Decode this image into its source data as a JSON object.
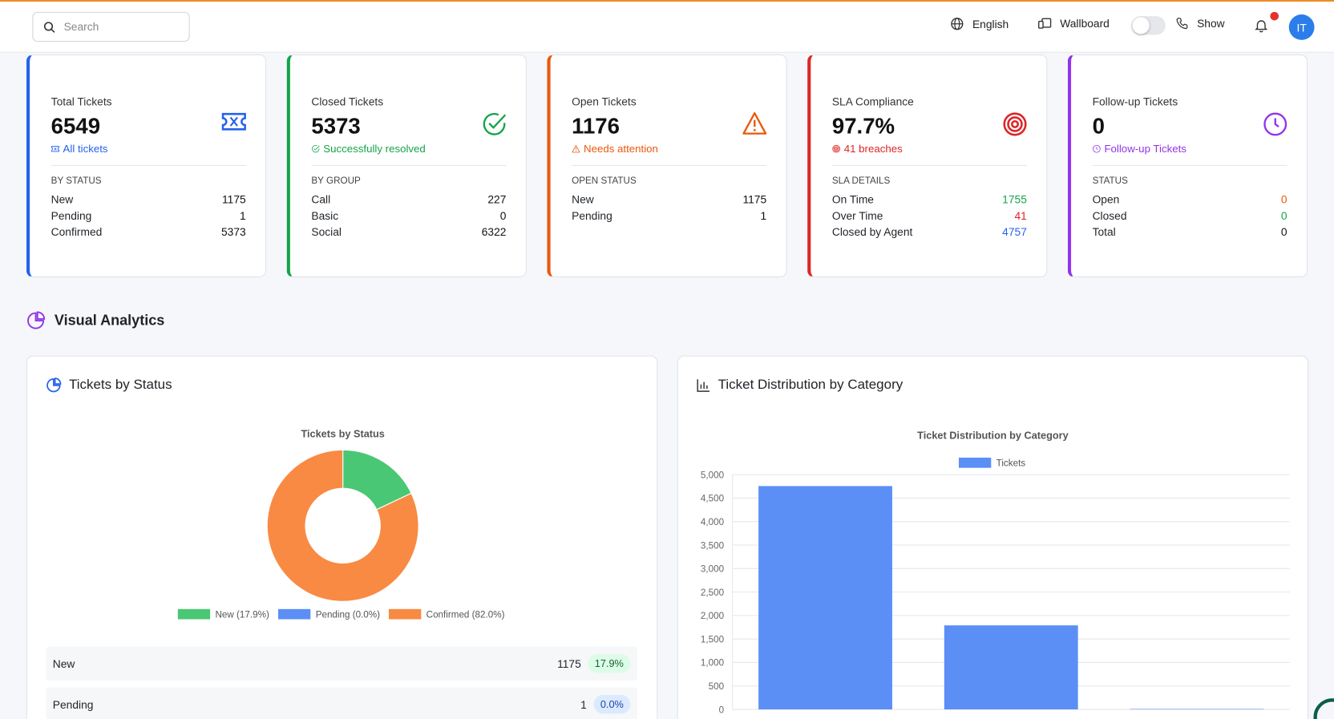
{
  "header": {
    "search_placeholder": "Search",
    "language": "English",
    "wallboard": "Wallboard",
    "show": "Show",
    "avatar_initials": "IT",
    "top_accent_color": "#f08a24"
  },
  "cards": [
    {
      "title": "Total Tickets",
      "value": "6549",
      "sub": "All tickets",
      "icon": "ticket-icon",
      "color": "#2563eb",
      "section": "BY STATUS",
      "rows": [
        {
          "label": "New",
          "value": "1175"
        },
        {
          "label": "Pending",
          "value": "1"
        },
        {
          "label": "Confirmed",
          "value": "5373"
        }
      ]
    },
    {
      "title": "Closed Tickets",
      "value": "5373",
      "sub": "Successfully resolved",
      "icon": "check-circle-icon",
      "color": "#16a34a",
      "section": "BY GROUP",
      "rows": [
        {
          "label": "Call",
          "value": "227"
        },
        {
          "label": "Basic",
          "value": "0"
        },
        {
          "label": "Social",
          "value": "6322"
        }
      ]
    },
    {
      "title": "Open Tickets",
      "value": "1176",
      "sub": "Needs attention",
      "icon": "warning-icon",
      "color": "#ea580c",
      "section": "OPEN STATUS",
      "rows": [
        {
          "label": "New",
          "value": "1175"
        },
        {
          "label": "Pending",
          "value": "1"
        }
      ]
    },
    {
      "title": "SLA Compliance",
      "value": "97.7%",
      "sub": "41 breaches",
      "icon": "target-icon",
      "color": "#dc2626",
      "section": "SLA DETAILS",
      "rows": [
        {
          "label": "On Time",
          "value": "1755",
          "color": "#16a34a"
        },
        {
          "label": "Over Time",
          "value": "41",
          "color": "#dc2626"
        },
        {
          "label": "Closed by Agent",
          "value": "4757",
          "color": "#2563eb"
        }
      ]
    },
    {
      "title": "Follow-up Tickets",
      "value": "0",
      "sub": "Follow-up Tickets",
      "icon": "clock-icon",
      "color": "#9333ea",
      "section": "STATUS",
      "rows": [
        {
          "label": "Open",
          "value": "0",
          "color": "#ea580c"
        },
        {
          "label": "Closed",
          "value": "0",
          "color": "#16a34a"
        },
        {
          "label": "Total",
          "value": "0"
        }
      ]
    }
  ],
  "section_title": "Visual Analytics",
  "status_panel": {
    "title": "Tickets by Status",
    "rows": [
      {
        "label": "New",
        "count": "1175",
        "pct": "17.9%",
        "badge_bg": "#dcfce7",
        "badge_fg": "#166534"
      },
      {
        "label": "Pending",
        "count": "1",
        "pct": "0.0%",
        "badge_bg": "#dbeafe",
        "badge_fg": "#1e40af"
      }
    ]
  },
  "category_panel": {
    "title": "Ticket Distribution by Category"
  },
  "chart_data": [
    {
      "type": "pie",
      "title": "Tickets by Status",
      "donut": true,
      "labels": [
        "New",
        "Pending",
        "Confirmed"
      ],
      "values": [
        1175,
        1,
        5373
      ],
      "legend": [
        "New (17.9%)",
        "Pending (0.0%)",
        "Confirmed (82.0%)"
      ],
      "colors": [
        "#4ac774",
        "#5b8ff5",
        "#f98a43"
      ],
      "legend_position": "bottom"
    },
    {
      "type": "bar",
      "title": "Ticket Distribution by Category",
      "series": [
        {
          "name": "Tickets",
          "values": [
            4757,
            1790,
            10
          ]
        }
      ],
      "categories": [
        "",
        "",
        ""
      ],
      "ylim": [
        0,
        5000
      ],
      "yticks": [
        "0",
        "500",
        "1,000",
        "1,500",
        "2,000",
        "2,500",
        "3,000",
        "3,500",
        "4,000",
        "4,500",
        "5,000"
      ],
      "grid": true,
      "legend_position": "top",
      "color": "#5b8ff5"
    }
  ]
}
